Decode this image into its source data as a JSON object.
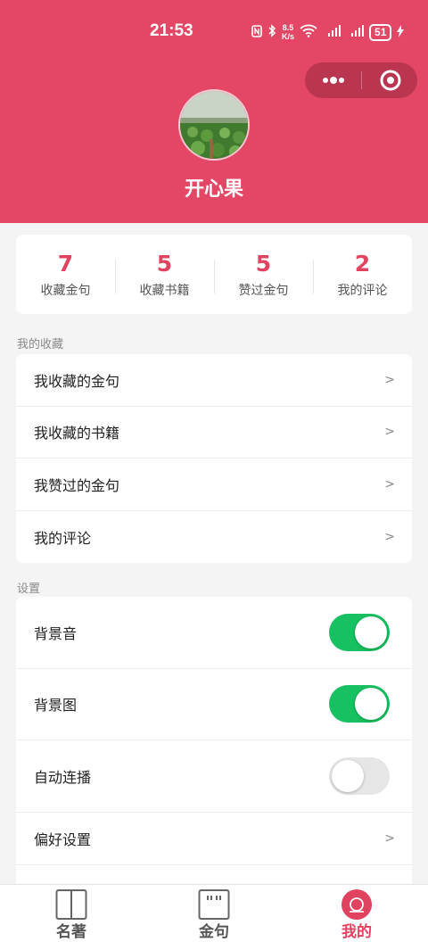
{
  "status_bar": {
    "time": "21:53",
    "net_speed_value": "8.5",
    "net_speed_unit": "K/s",
    "battery": "51"
  },
  "profile": {
    "nickname": "开心果"
  },
  "stats": [
    {
      "value": "7",
      "label": "收藏金句"
    },
    {
      "value": "5",
      "label": "收藏书籍"
    },
    {
      "value": "5",
      "label": "赞过金句"
    },
    {
      "value": "2",
      "label": "我的评论"
    }
  ],
  "favorites": {
    "title": "我的收藏",
    "items": [
      {
        "label": "我收藏的金句",
        "arrow": ">"
      },
      {
        "label": "我收藏的书籍",
        "arrow": ">"
      },
      {
        "label": "我赞过的金句",
        "arrow": ">"
      },
      {
        "label": "我的评论",
        "arrow": ">"
      }
    ]
  },
  "settings": {
    "title": "设置",
    "items": [
      {
        "label": "背景音",
        "on": true
      },
      {
        "label": "背景图",
        "on": true
      },
      {
        "label": "自动连播",
        "on": false
      }
    ],
    "preferences": {
      "label": "偏好设置",
      "arrow": ">"
    }
  },
  "tab_bar": {
    "tabs": [
      {
        "label": "名著",
        "icon": "book-icon",
        "active": false
      },
      {
        "label": "金句",
        "icon": "quote-icon",
        "active": false
      },
      {
        "label": "我的",
        "icon": "profile-icon",
        "active": true
      }
    ]
  },
  "colors": {
    "brand": "#e44766",
    "accent": "#e0435f",
    "toggle_on": "#17c060",
    "toggle_off": "#e6e6e6"
  }
}
